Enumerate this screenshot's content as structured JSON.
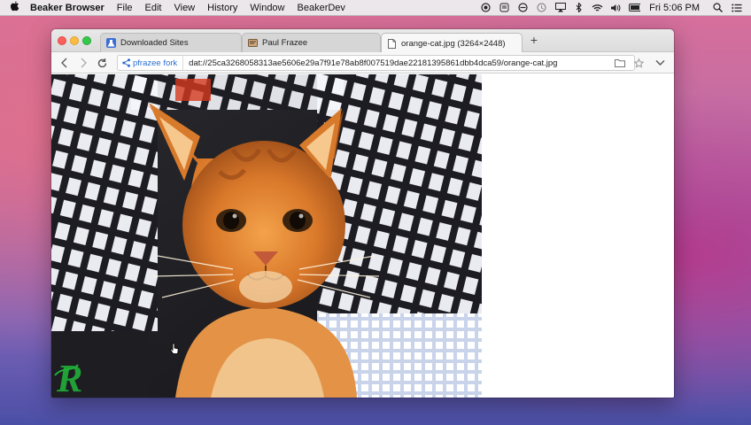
{
  "menubar": {
    "app_name": "Beaker Browser",
    "items": [
      "File",
      "Edit",
      "View",
      "History",
      "Window",
      "BeakerDev"
    ],
    "clock": "Fri 5:06 PM",
    "status_icons": [
      "record-icon",
      "pocket-icon",
      "do-not-disturb-icon",
      "time-machine-icon",
      "airplay-icon",
      "bluetooth-icon",
      "wifi-icon",
      "volume-icon",
      "battery-icon",
      "spotlight-icon",
      "notification-center-icon"
    ]
  },
  "tabs": [
    {
      "title": "Downloaded Sites",
      "icon": "beaker-icon",
      "active": false
    },
    {
      "title": "Paul Frazee",
      "icon": "site-favicon",
      "active": false
    },
    {
      "title": "orange-cat.jpg (3264×2448)",
      "icon": "document-icon",
      "active": true
    }
  ],
  "newtab_label": "+",
  "nav": {
    "fork_label": "pfrazee fork",
    "url": "dat://25ca3268058313ae5606e29a7f91e78ab8f007519dae22181395861dbb4dca59/orange-cat.jpg"
  },
  "photo": {
    "watermark": "R"
  },
  "colors": {
    "accent": "#2a6fd0",
    "close": "#fc605c",
    "minimize": "#fdbc40",
    "zoom": "#34c84a"
  }
}
